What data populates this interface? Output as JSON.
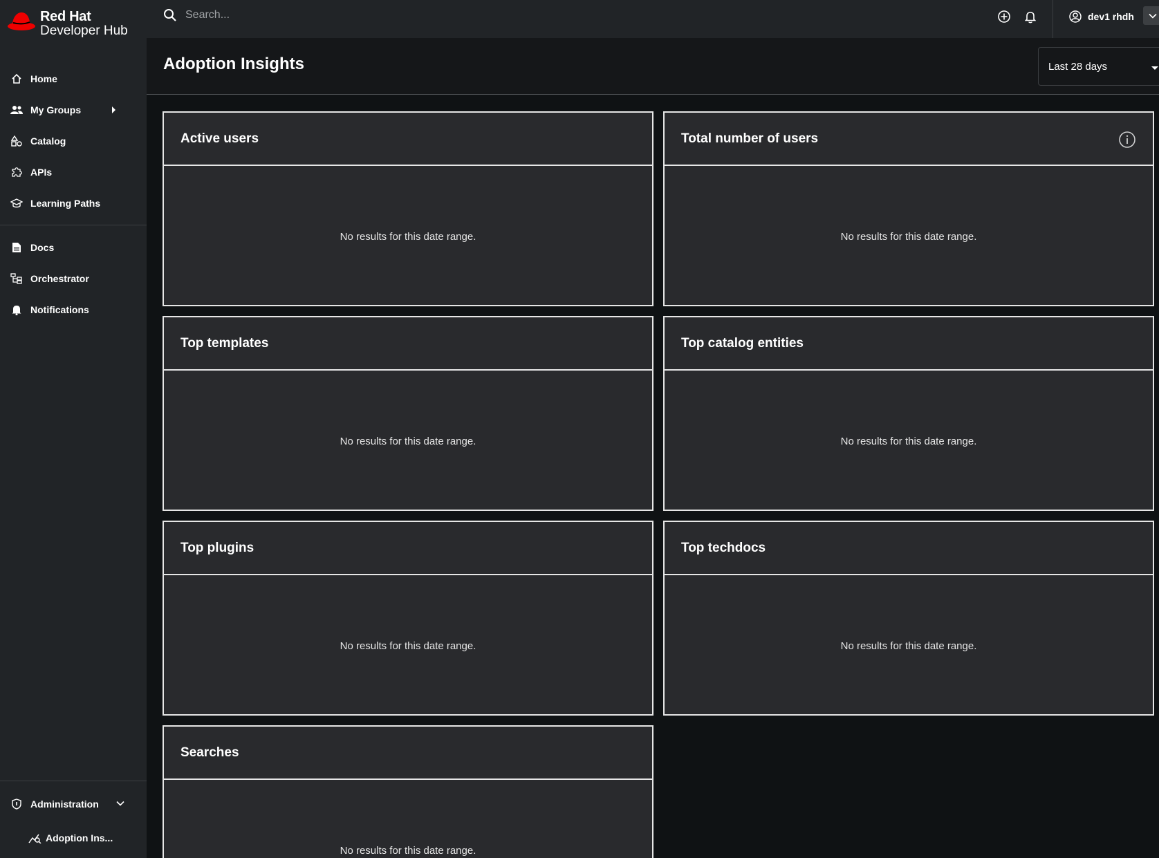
{
  "brand": {
    "line1": "Red Hat",
    "line2": "Developer Hub"
  },
  "sidebar": {
    "items": [
      {
        "label": "Home",
        "icon": "home-icon"
      },
      {
        "label": "My Groups",
        "icon": "users-icon"
      },
      {
        "label": "Catalog",
        "icon": "catalog-icon"
      },
      {
        "label": "APIs",
        "icon": "puzzle-icon"
      },
      {
        "label": "Learning Paths",
        "icon": "graduation-cap-icon"
      },
      {
        "label": "Docs",
        "icon": "document-icon"
      },
      {
        "label": "Orchestrator",
        "icon": "workflow-icon"
      },
      {
        "label": "Notifications",
        "icon": "bell-icon"
      }
    ],
    "admin": {
      "label": "Administration",
      "icon": "shield-icon"
    },
    "admin_sub": {
      "label": "Adoption Ins...",
      "icon": "analytics-icon"
    }
  },
  "topbar": {
    "search_placeholder": "Search...",
    "user_name": "dev1 rhdh"
  },
  "header": {
    "title": "Adoption Insights",
    "date_range": "Last 28 days"
  },
  "cards": [
    {
      "title": "Active users",
      "empty": "No results for this date range."
    },
    {
      "title": "Total number of users",
      "empty": "No results for this date range."
    },
    {
      "title": "Top templates",
      "empty": "No results for this date range."
    },
    {
      "title": "Top catalog entities",
      "empty": "No results for this date range."
    },
    {
      "title": "Top plugins",
      "empty": "No results for this date range."
    },
    {
      "title": "Top techdocs",
      "empty": "No results for this date range."
    },
    {
      "title": "Searches",
      "empty": "No results for this date range."
    }
  ],
  "colors": {
    "page_bg": "#0f1214",
    "sidebar_bg": "#212427",
    "card_bg": "#292a2d",
    "card_border": "#e6e6e6",
    "brand_red": "#ee0000"
  }
}
